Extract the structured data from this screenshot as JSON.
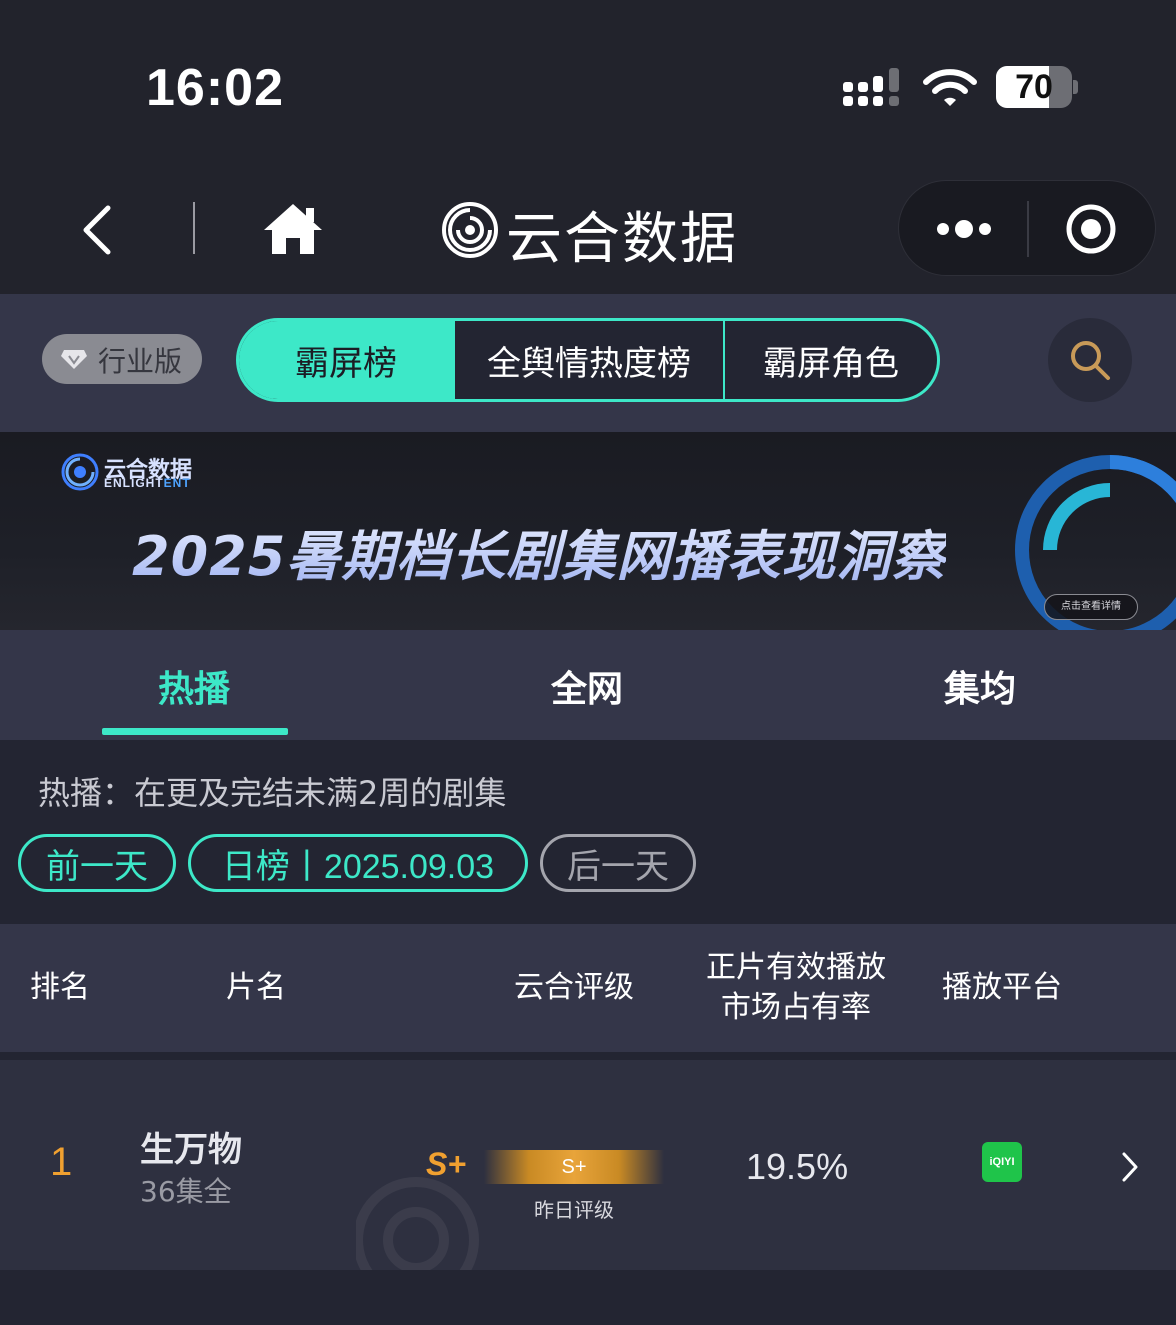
{
  "status_bar": {
    "time": "16:02",
    "battery_level": 70,
    "battery_text": "70"
  },
  "nav": {
    "app_title": "云合数据",
    "icons": [
      "back-icon",
      "home-icon",
      "app-logo-icon",
      "more-icon",
      "target-icon"
    ]
  },
  "tab_strip": {
    "edition_label": "行业版",
    "segments": [
      "霸屏榜",
      "全舆情热度榜",
      "霸屏角色"
    ],
    "active_segment": 0
  },
  "banner": {
    "brand_cn": "云合数据",
    "brand_en_prefix": "ENLIGHT",
    "brand_en_suffix": "ENT",
    "title": "2025暑期档长剧集网播表现洞察",
    "cta": "点击查看详情"
  },
  "sub_tabs": {
    "items": [
      "热播",
      "全网",
      "集均"
    ],
    "active": 0
  },
  "filter": {
    "description": "热播：在更及完结未满2周的剧集",
    "prev_label": "前一天",
    "date_label": "日榜丨2025.09.03",
    "next_label": "后一天"
  },
  "table": {
    "columns": {
      "rank": "排名",
      "title": "片名",
      "rating": "云合评级",
      "share_line1": "正片有效播放",
      "share_line2": "市场占有率",
      "platform": "播放平台"
    },
    "rows": [
      {
        "rank": "1",
        "title": "生万物",
        "episodes": "36集全",
        "rating": "S+",
        "yesterday_rating": "S+",
        "yesterday_rating_label": "昨日评级",
        "share": "19.5%",
        "platform": "iQIYI"
      }
    ]
  },
  "colors": {
    "accent": "#3de8c8",
    "rank_orange": "#f0a030",
    "background": "#232532",
    "panel": "#343649",
    "iqiyi_green": "#1fc44a"
  }
}
